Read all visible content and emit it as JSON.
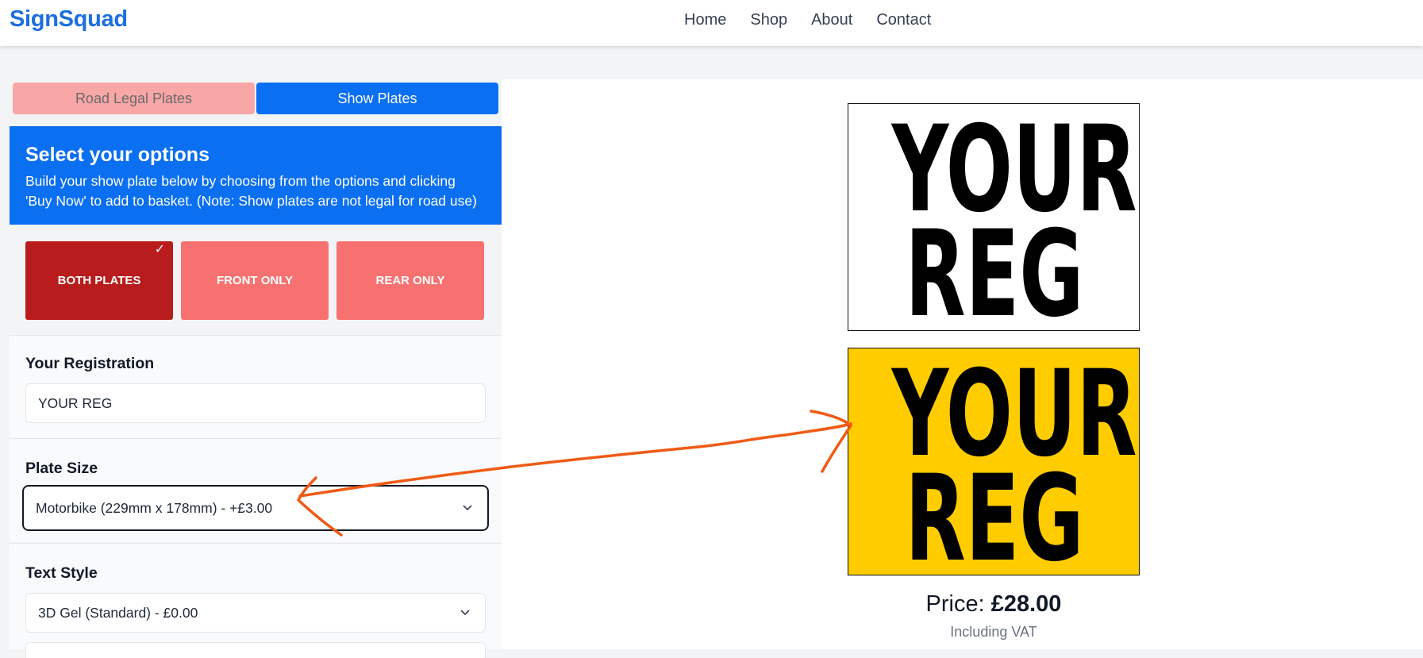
{
  "header": {
    "logo": "SignSquad",
    "nav": [
      "Home",
      "Shop",
      "About",
      "Contact"
    ]
  },
  "tabs": {
    "road_legal": "Road Legal Plates",
    "show_plates": "Show Plates",
    "active": "show_plates"
  },
  "options": {
    "title": "Select your options",
    "description": "Build your show plate below by choosing from the options and clicking 'Buy Now' to add to basket. (Note: Show plates are not legal for road use)"
  },
  "plate_choice": {
    "items": [
      {
        "label": "BOTH PLATES",
        "selected": true
      },
      {
        "label": "FRONT ONLY",
        "selected": false
      },
      {
        "label": "REAR ONLY",
        "selected": false
      }
    ],
    "check_mark": "✓"
  },
  "registration": {
    "label": "Your Registration",
    "value": "YOUR REG"
  },
  "plate_size": {
    "label": "Plate Size",
    "selected": "Motorbike (229mm x 178mm) - +£3.00"
  },
  "text_style": {
    "label": "Text Style",
    "selected": "3D Gel (Standard) - £0.00"
  },
  "preview": {
    "front_line1": "YOUR",
    "front_line2": "REG",
    "rear_line1": "YOUR",
    "rear_line2": "REG",
    "front_color": "#ffffff",
    "rear_color": "#ffcc00"
  },
  "price": {
    "label": "Price: ",
    "amount": "£28.00",
    "note": "Including VAT"
  },
  "colors": {
    "brand": "#1d6fe0",
    "primary": "#0b6ff1",
    "selected_red": "#b91c1c",
    "unselected_red": "#f87171",
    "annotation": "#f05a14"
  }
}
